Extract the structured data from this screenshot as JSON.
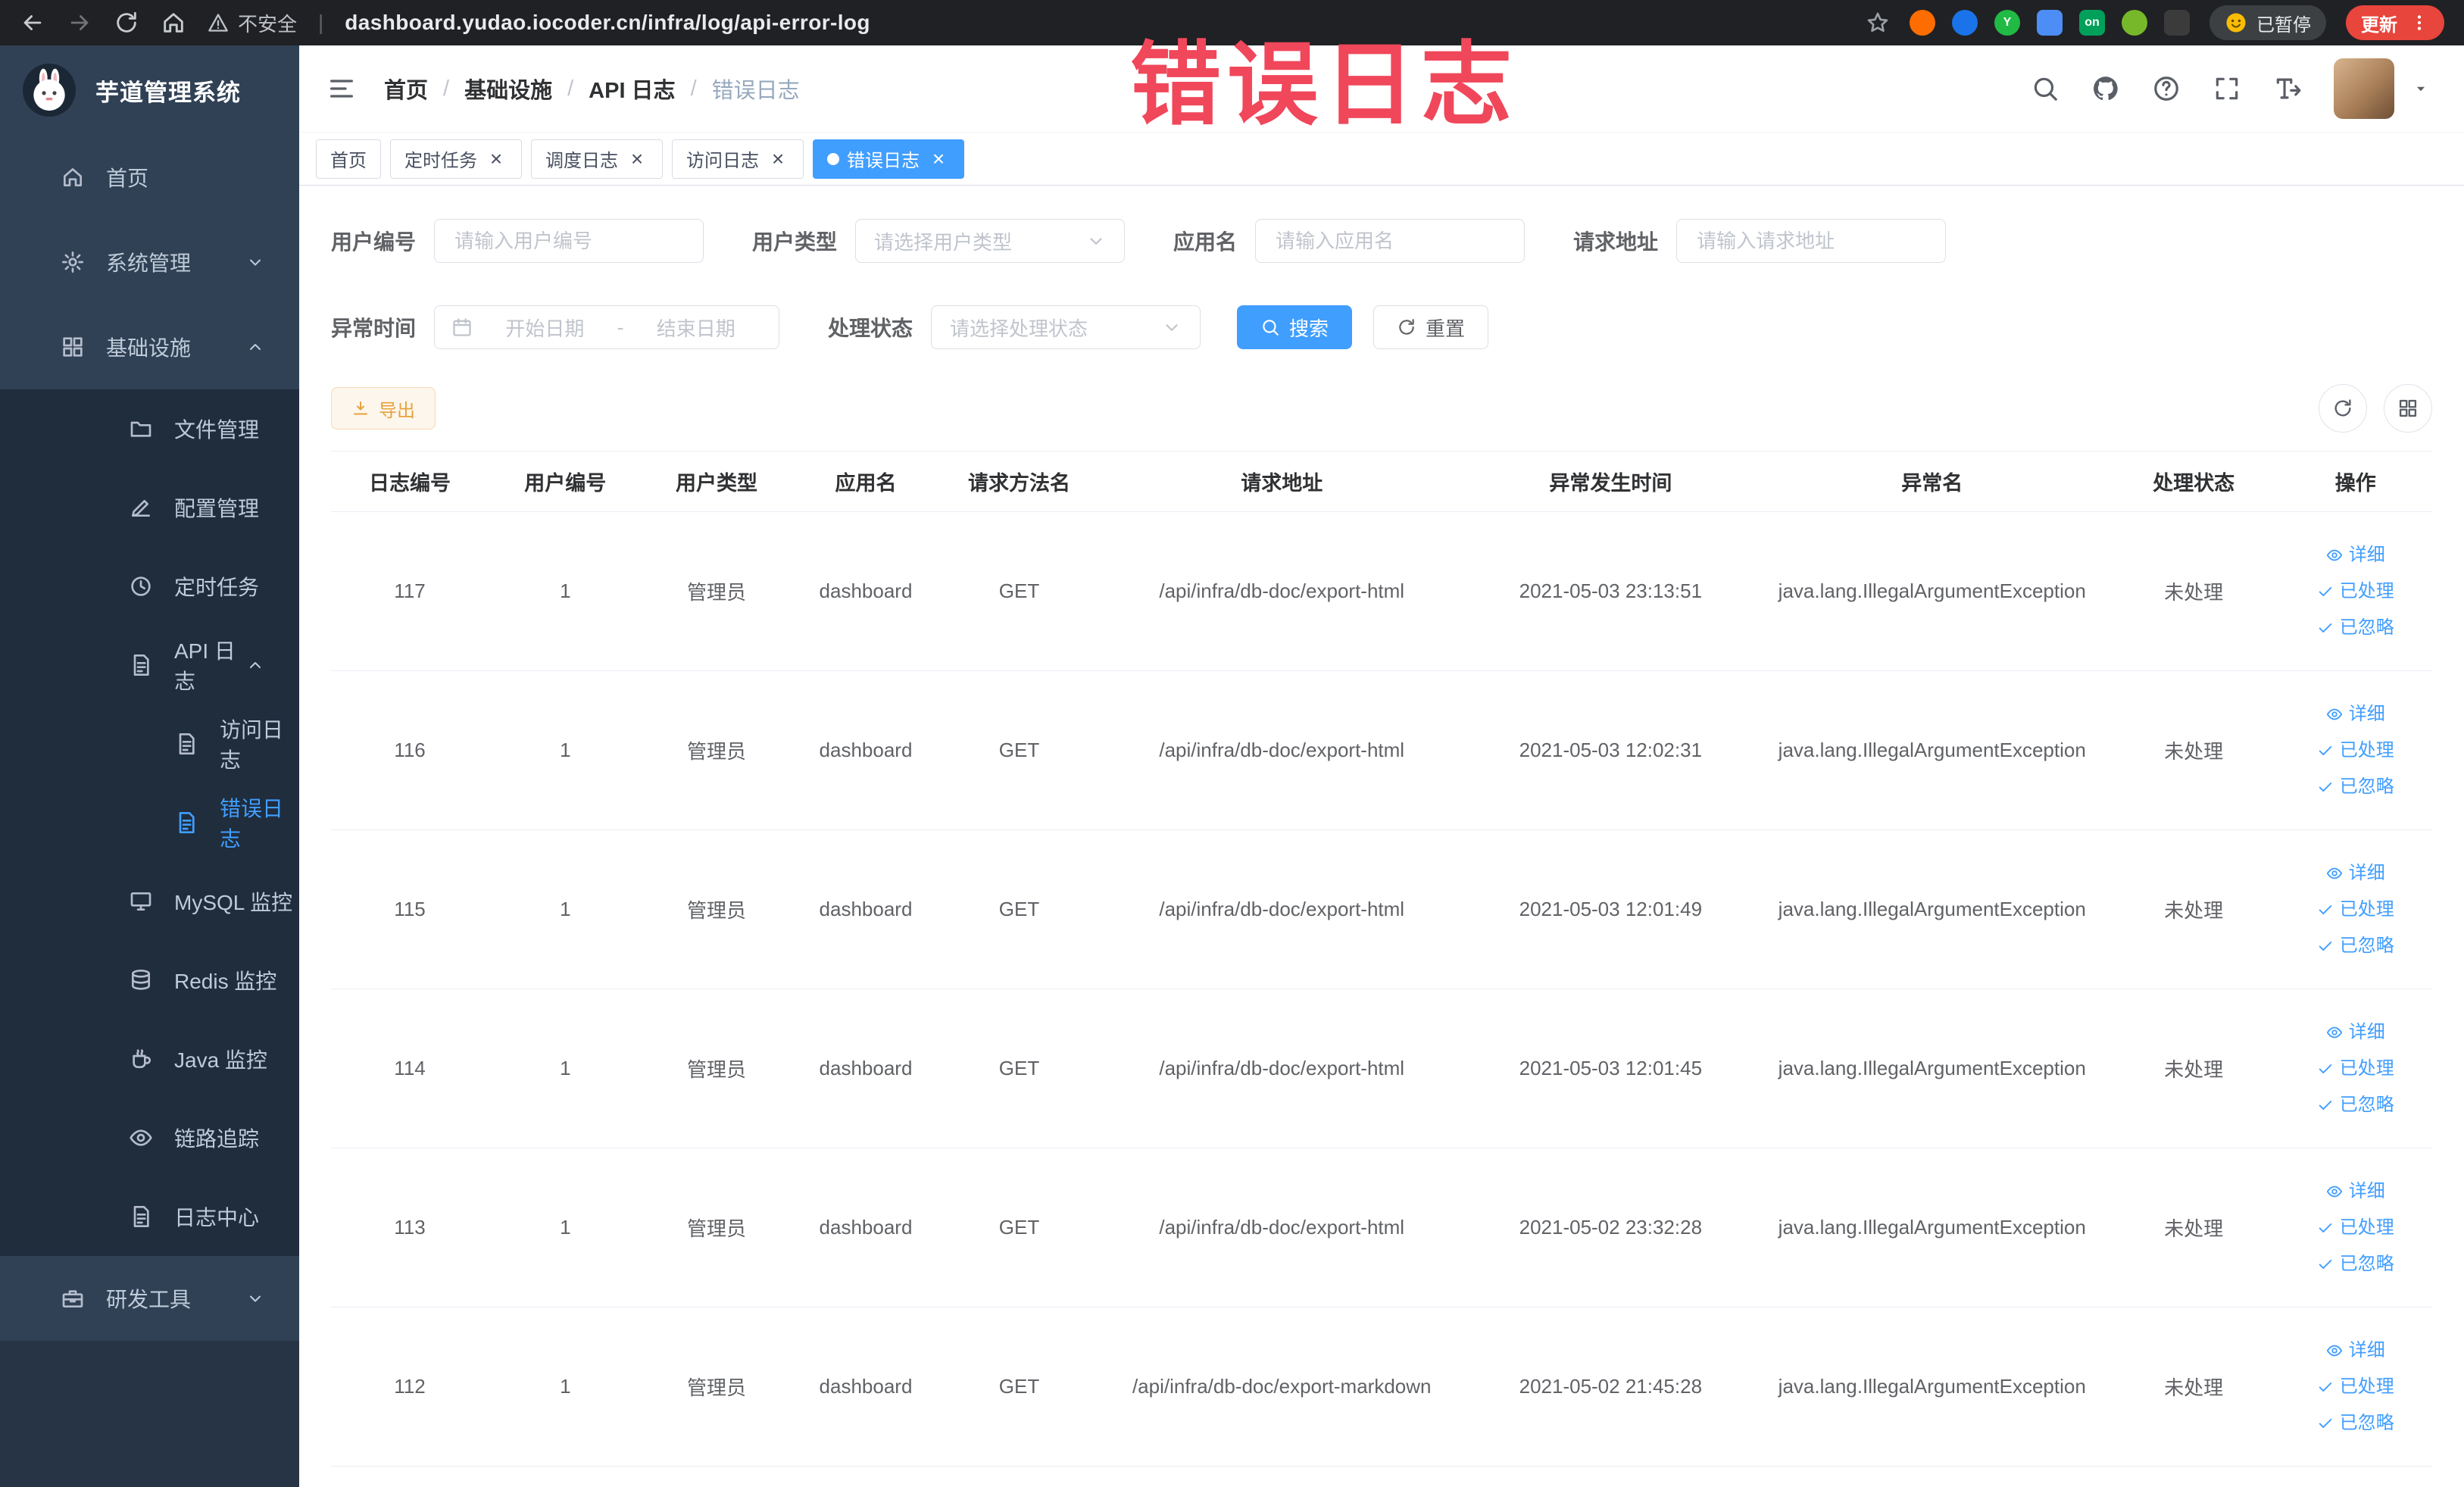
{
  "watermark": "错误日志",
  "browser": {
    "security_label": "不安全",
    "url": "dashboard.yudao.iocoder.cn/infra/log/api-error-log",
    "paused_label": "已暂停",
    "update_label": "更新",
    "extensions": [
      {
        "name": "extension-orange-circle",
        "color": "#ff6d00",
        "shape": "circle",
        "text": ""
      },
      {
        "name": "extension-blue-circle",
        "color": "#1a73e8",
        "shape": "circle",
        "text": ""
      },
      {
        "name": "extension-green-circle",
        "color": "#21ba45",
        "shape": "circle",
        "text": "Y"
      },
      {
        "name": "extension-blue-grid",
        "color": "#4d8df6",
        "shape": "square",
        "text": ""
      },
      {
        "name": "extension-green-on",
        "color": "#00a05a",
        "shape": "square",
        "text": "on"
      },
      {
        "name": "extension-green-leaf",
        "color": "#76b82a",
        "shape": "circle",
        "text": ""
      },
      {
        "name": "extension-dark-puzzle",
        "color": "#3b3b3b",
        "shape": "square",
        "text": ""
      }
    ]
  },
  "sidebar": {
    "logo_title": "芋道管理系统",
    "menu": [
      {
        "icon": "home",
        "label": "首页",
        "level": 0
      },
      {
        "icon": "gear",
        "label": "系统管理",
        "level": 0,
        "chevron": "down"
      },
      {
        "icon": "grid",
        "label": "基础设施",
        "level": 0,
        "chevron": "up"
      },
      {
        "icon": "folder",
        "label": "文件管理",
        "level": 1
      },
      {
        "icon": "edit",
        "label": "配置管理",
        "level": 1
      },
      {
        "icon": "clock",
        "label": "定时任务",
        "level": 1
      },
      {
        "icon": "doc",
        "label": "API 日志",
        "level": 1,
        "chevron": "up"
      },
      {
        "icon": "doc",
        "label": "访问日志",
        "level": 2
      },
      {
        "icon": "doc",
        "label": "错误日志",
        "level": 2,
        "active": true
      },
      {
        "icon": "monitor",
        "label": "MySQL 监控",
        "level": 1
      },
      {
        "icon": "coins",
        "label": "Redis 监控",
        "level": 1
      },
      {
        "icon": "java",
        "label": "Java 监控",
        "level": 1
      },
      {
        "icon": "eye",
        "label": "链路追踪",
        "level": 1
      },
      {
        "icon": "doc",
        "label": "日志中心",
        "level": 1
      },
      {
        "icon": "toolbox",
        "label": "研发工具",
        "level": 0,
        "chevron": "down"
      }
    ]
  },
  "header": {
    "breadcrumb": [
      "首页",
      "基础设施",
      "API 日志",
      "错误日志"
    ]
  },
  "tabs": [
    {
      "label": "首页",
      "closable": false,
      "active": false
    },
    {
      "label": "定时任务",
      "closable": true,
      "active": false
    },
    {
      "label": "调度日志",
      "closable": true,
      "active": false
    },
    {
      "label": "访问日志",
      "closable": true,
      "active": false
    },
    {
      "label": "错误日志",
      "closable": true,
      "active": true
    }
  ],
  "filters": {
    "user_id": {
      "label": "用户编号",
      "placeholder": "请输入用户编号"
    },
    "user_type": {
      "label": "用户类型",
      "placeholder": "请选择用户类型"
    },
    "app_name": {
      "label": "应用名",
      "placeholder": "请输入应用名"
    },
    "request_url": {
      "label": "请求地址",
      "placeholder": "请输入请求地址"
    },
    "exception_time": {
      "label": "异常时间",
      "start_placeholder": "开始日期",
      "separator": "-",
      "end_placeholder": "结束日期"
    },
    "process_status": {
      "label": "处理状态",
      "placeholder": "请选择处理状态"
    },
    "search_label": "搜索",
    "reset_label": "重置"
  },
  "toolbar": {
    "export_label": "导出"
  },
  "table": {
    "columns": [
      "日志编号",
      "用户编号",
      "用户类型",
      "应用名",
      "请求方法名",
      "请求地址",
      "异常发生时间",
      "异常名",
      "处理状态",
      "操作"
    ],
    "row_actions": [
      "详细",
      "已处理",
      "已忽略"
    ],
    "rows": [
      {
        "id": "117",
        "user_id": "1",
        "user_type": "管理员",
        "app": "dashboard",
        "method": "GET",
        "url": "/api/infra/db-doc/export-html",
        "time": "2021-05-03 23:13:51",
        "exception": "java.lang.IllegalArgumentException",
        "status": "未处理"
      },
      {
        "id": "116",
        "user_id": "1",
        "user_type": "管理员",
        "app": "dashboard",
        "method": "GET",
        "url": "/api/infra/db-doc/export-html",
        "time": "2021-05-03 12:02:31",
        "exception": "java.lang.IllegalArgumentException",
        "status": "未处理"
      },
      {
        "id": "115",
        "user_id": "1",
        "user_type": "管理员",
        "app": "dashboard",
        "method": "GET",
        "url": "/api/infra/db-doc/export-html",
        "time": "2021-05-03 12:01:49",
        "exception": "java.lang.IllegalArgumentException",
        "status": "未处理"
      },
      {
        "id": "114",
        "user_id": "1",
        "user_type": "管理员",
        "app": "dashboard",
        "method": "GET",
        "url": "/api/infra/db-doc/export-html",
        "time": "2021-05-03 12:01:45",
        "exception": "java.lang.IllegalArgumentException",
        "status": "未处理"
      },
      {
        "id": "113",
        "user_id": "1",
        "user_type": "管理员",
        "app": "dashboard",
        "method": "GET",
        "url": "/api/infra/db-doc/export-html",
        "time": "2021-05-02 23:32:28",
        "exception": "java.lang.IllegalArgumentException",
        "status": "未处理"
      },
      {
        "id": "112",
        "user_id": "1",
        "user_type": "管理员",
        "app": "dashboard",
        "method": "GET",
        "url": "/api/infra/db-doc/export-markdown",
        "time": "2021-05-02 21:45:28",
        "exception": "java.lang.IllegalArgumentException",
        "status": "未处理"
      }
    ]
  },
  "colors": {
    "primary": "#409eff",
    "warning": "#e6a23c",
    "sidebar_bg": "#304156",
    "submenu_bg": "#1f2d3d",
    "active_tab": "#409eff",
    "watermark_red": "#f0475a",
    "update_button": "#e8453c"
  }
}
